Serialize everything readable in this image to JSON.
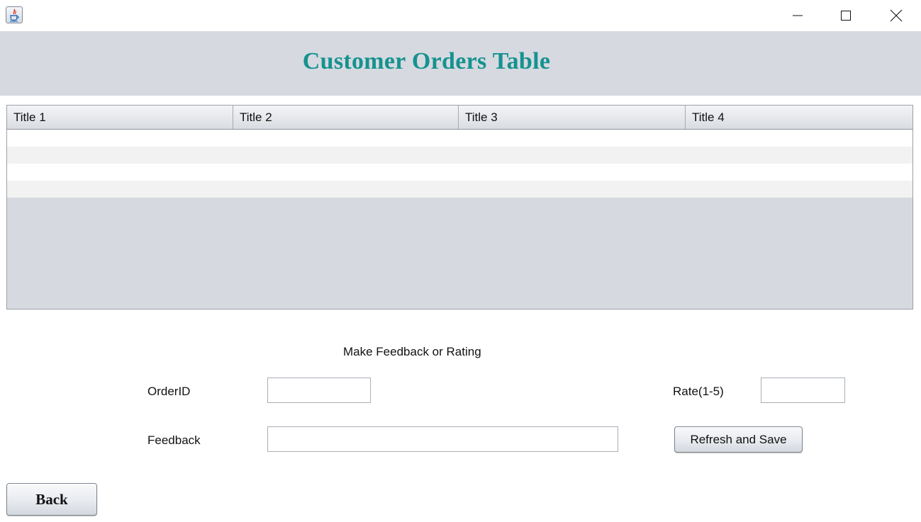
{
  "window": {
    "minimize_icon": "minimize-icon",
    "maximize_icon": "maximize-icon",
    "close_icon": "close-icon",
    "app_icon": "java-app-icon"
  },
  "header": {
    "title": "Customer Orders Table",
    "title_color": "#16928f",
    "background": "#d6d9e0"
  },
  "table": {
    "columns": [
      "Title 1",
      "Title 2",
      "Title 3",
      "Title 4"
    ],
    "rows": [
      [
        "",
        "",
        "",
        ""
      ],
      [
        "",
        "",
        "",
        ""
      ],
      [
        "",
        "",
        "",
        ""
      ],
      [
        "",
        "",
        "",
        ""
      ]
    ]
  },
  "form": {
    "section_label": "Make Feedback or Rating",
    "orderid_label": "OrderID",
    "orderid_value": "",
    "rate_label": "Rate(1-5)",
    "rate_value": "",
    "feedback_label": "Feedback",
    "feedback_value": "",
    "refresh_save_label": "Refresh and Save"
  },
  "footer": {
    "back_label": "Back"
  }
}
